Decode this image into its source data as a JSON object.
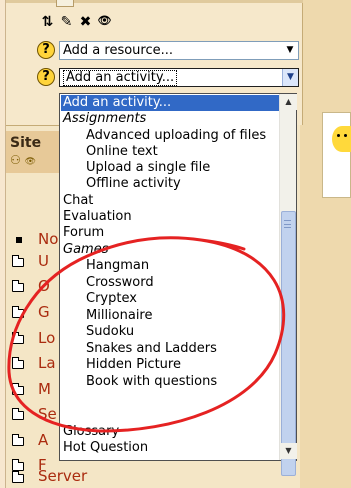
{
  "edit_icons": {
    "move": "⇅",
    "edit": "✎",
    "delete": "✖",
    "view": "👁"
  },
  "resource_select": {
    "value": "Add a resource...",
    "help_icon": "?"
  },
  "activity_select": {
    "value": "Add an activity...",
    "help_icon": "?"
  },
  "site_panel": {
    "title": "Site",
    "items": [
      {
        "label": "No"
      },
      {
        "label": "U"
      },
      {
        "label": "O"
      },
      {
        "label": "G"
      },
      {
        "label": "Lo"
      },
      {
        "label": "La"
      },
      {
        "label": "M"
      },
      {
        "label": "Se"
      },
      {
        "label": "A"
      },
      {
        "label": "F"
      },
      {
        "label": "Server"
      }
    ]
  },
  "dropdown": {
    "options": [
      {
        "label": "Add an activity...",
        "kind": "selected"
      },
      {
        "label": "Assignments",
        "kind": "group"
      },
      {
        "label": "Advanced uploading of files",
        "kind": "child"
      },
      {
        "label": "Online text",
        "kind": "child"
      },
      {
        "label": "Upload a single file",
        "kind": "child"
      },
      {
        "label": "Offline activity",
        "kind": "child"
      },
      {
        "label": "Chat",
        "kind": "item"
      },
      {
        "label": "Evaluation",
        "kind": "item"
      },
      {
        "label": "Forum",
        "kind": "item"
      },
      {
        "label": "Games",
        "kind": "group"
      },
      {
        "label": "Hangman",
        "kind": "child"
      },
      {
        "label": "Crossword",
        "kind": "child"
      },
      {
        "label": "Cryptex",
        "kind": "child"
      },
      {
        "label": "Millionaire",
        "kind": "child"
      },
      {
        "label": "Sudoku",
        "kind": "child"
      },
      {
        "label": "Snakes and Ladders",
        "kind": "child"
      },
      {
        "label": "Hidden Picture",
        "kind": "child"
      },
      {
        "label": "Book with questions",
        "kind": "child"
      },
      {
        "label": "Glossary",
        "kind": "item"
      },
      {
        "label": "Hot Question",
        "kind": "item"
      }
    ]
  },
  "colors": {
    "annotation": "#e52222",
    "highlight": "#3169c6",
    "link": "#aa2b0f"
  }
}
